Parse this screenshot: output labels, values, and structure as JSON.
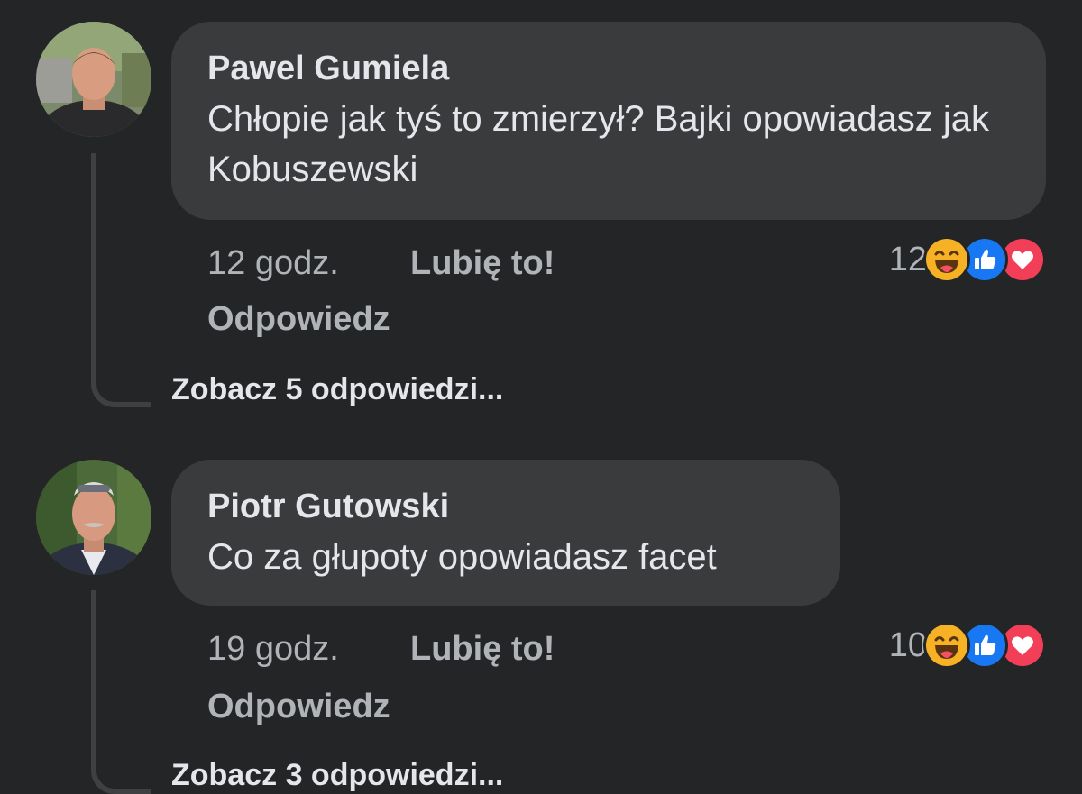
{
  "comments": [
    {
      "author": "Pawel Gumiela",
      "text": "Chłopie jak tyś to zmierzył? Bajki opowiadasz jak Kobuszewski",
      "time": "12 godz.",
      "like_label": "Lubię to!",
      "reply_label": "Odpowiedz",
      "reaction_count": "12",
      "reactions": [
        "haha-icon",
        "like-icon",
        "love-icon"
      ],
      "see_replies": "Zobacz 5 odpowiedzi..."
    },
    {
      "author": "Piotr Gutowski",
      "text": "Co za głupoty opowiadasz facet",
      "time": "19 godz.",
      "like_label": "Lubię to!",
      "reply_label": "Odpowiedz",
      "reaction_count": "10",
      "reactions": [
        "haha-icon",
        "like-icon",
        "love-icon"
      ],
      "see_replies": "Zobacz 3 odpowiedzi..."
    }
  ],
  "colors": {
    "background": "#242526",
    "bubble": "#3a3b3c",
    "primary_text": "#e4e6eb",
    "secondary_text": "#b0b3b8",
    "like_blue": "#1877f2",
    "love_red": "#f33e58",
    "haha_yellow": "#f7b125"
  }
}
